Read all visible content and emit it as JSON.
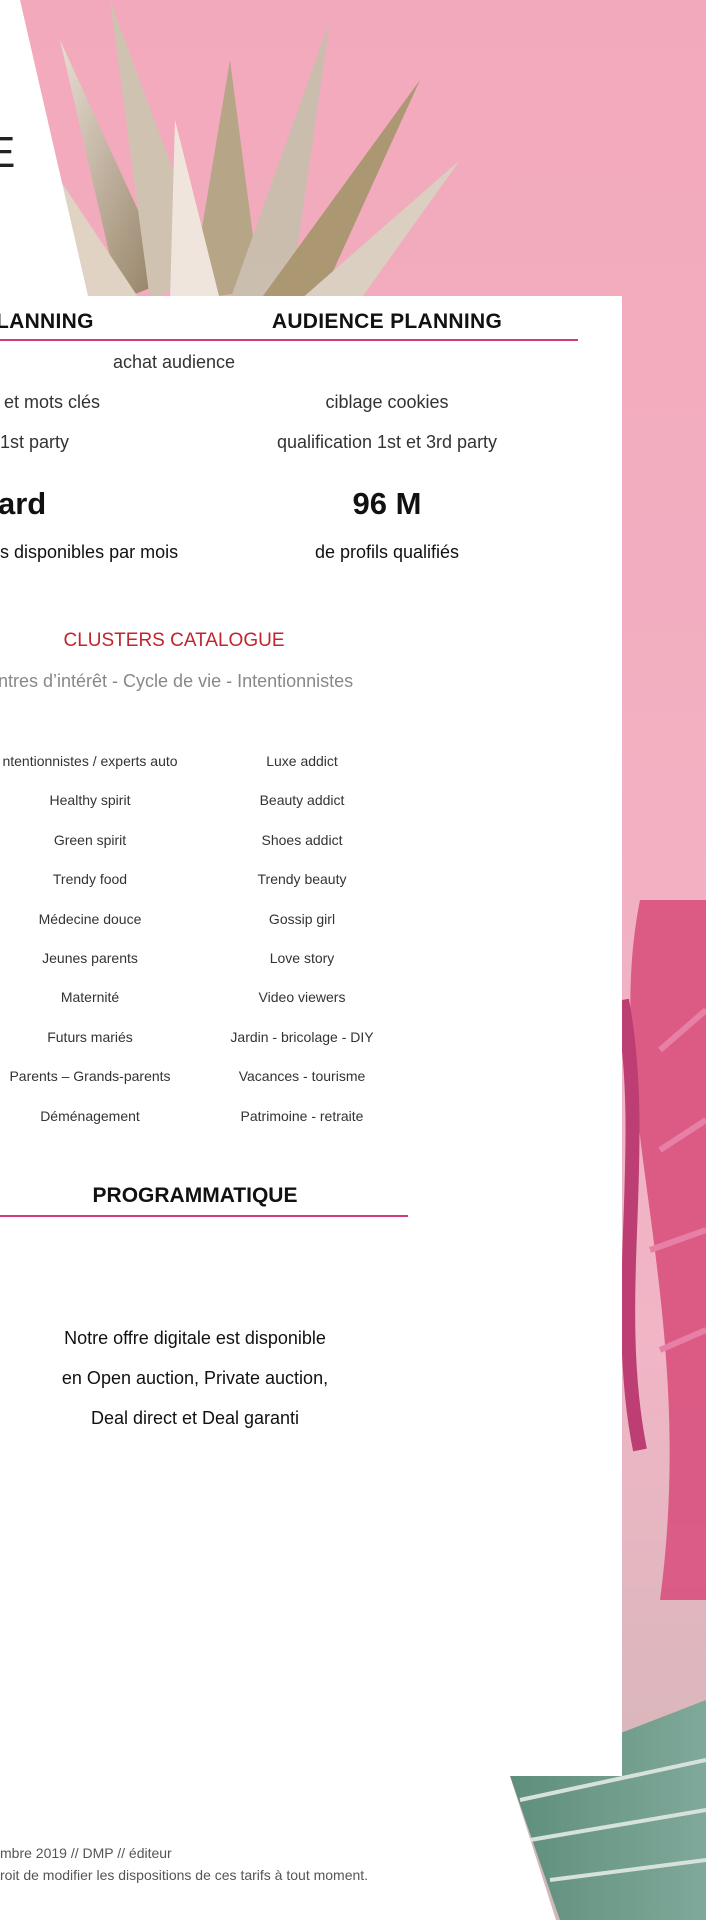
{
  "hero": {
    "partial_letter": "E"
  },
  "columns": {
    "left": {
      "header": "LANNING",
      "rows": [
        "et mots clés",
        "1st party"
      ],
      "figure": "ard",
      "caption": "s disponibles par mois"
    },
    "shared_row": "achat  audience",
    "right": {
      "header": "AUDIENCE  PLANNING",
      "rows": [
        "ciblage cookies",
        "qualification 1st et 3rd party"
      ],
      "figure": "96 M",
      "caption": "de profils qualifiés"
    }
  },
  "clusters": {
    "title": "CLUSTERS CATALOGUE",
    "subtitle": "ntres d’intérêt - Cycle de vie - Intentionnistes",
    "left": [
      "ntentionnistes / experts auto",
      "Healthy spirit",
      "Green spirit",
      "Trendy food",
      "Médecine douce",
      "Jeunes parents",
      "Maternité",
      "Futurs mariés",
      "Parents –  Grands-parents",
      "Déménagement"
    ],
    "right": [
      "Luxe addict",
      "Beauty addict",
      "Shoes addict",
      "Trendy beauty",
      "Gossip girl",
      "Love story",
      "Video viewers",
      "Jardin - bricolage - DIY",
      "Vacances - tourisme",
      "Patrimoine - retraite"
    ]
  },
  "programmatique": {
    "title": "PROGRAMMATIQUE",
    "lines": [
      "Notre offre digitale est disponible",
      "en Open auction, Private auction,",
      "Deal direct et Deal garanti"
    ]
  },
  "footer": {
    "line1": "mbre 2019 // DMP // éditeur",
    "line2": "roit de modifier les dispositions de ces tarifs à tout moment."
  },
  "colors": {
    "accent": "#d23a7c",
    "cluster_title": "#c0242f",
    "background": "#f0b3c3"
  }
}
